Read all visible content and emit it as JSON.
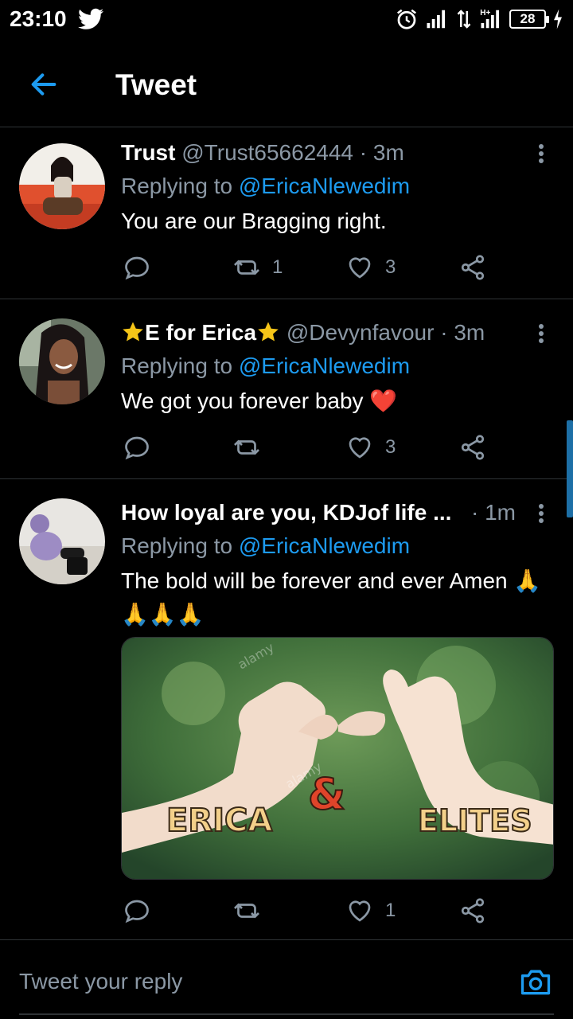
{
  "status_bar": {
    "time": "23:10",
    "battery": "28",
    "icons": [
      "twitter-icon",
      "alarm-icon",
      "signal-icon",
      "data-arrows-icon",
      "hplus-signal-icon",
      "battery-icon",
      "charging-icon"
    ]
  },
  "header": {
    "title": "Tweet",
    "back_icon": "arrow-left-icon"
  },
  "tweets": [
    {
      "name": "Trust",
      "handle": "@Trust65662444",
      "time": "· 3m",
      "replying_label": "Replying to",
      "replying_handle": "@EricaNlewedim",
      "text": "You are our Bragging right.",
      "retweets": "1",
      "likes": "3"
    },
    {
      "name": "E for Erica",
      "handle": "@Devynfavour",
      "time": "· 3m",
      "replying_label": "Replying to",
      "replying_handle": "@EricaNlewedim",
      "text": "We got you forever baby ❤️",
      "retweets": "",
      "likes": "3"
    },
    {
      "name": "How loyal are you, KDJof life ...",
      "handle": "",
      "time": "· 1m",
      "replying_label": "Replying to",
      "replying_handle": "@EricaNlewedim",
      "text": "The bold will be forever and ever Amen 🙏🙏🙏🙏",
      "retweets": "",
      "likes": "1",
      "image": {
        "left_word": "ERICA",
        "ampersand": "&",
        "right_word": "ELITES",
        "watermark": "alamy"
      }
    }
  ],
  "reply_bar": {
    "placeholder": "Tweet your reply"
  },
  "colors": {
    "background": "#000000",
    "accent": "#1d9bf0",
    "secondary_text": "#8b98a5",
    "divider": "#2f3336"
  }
}
